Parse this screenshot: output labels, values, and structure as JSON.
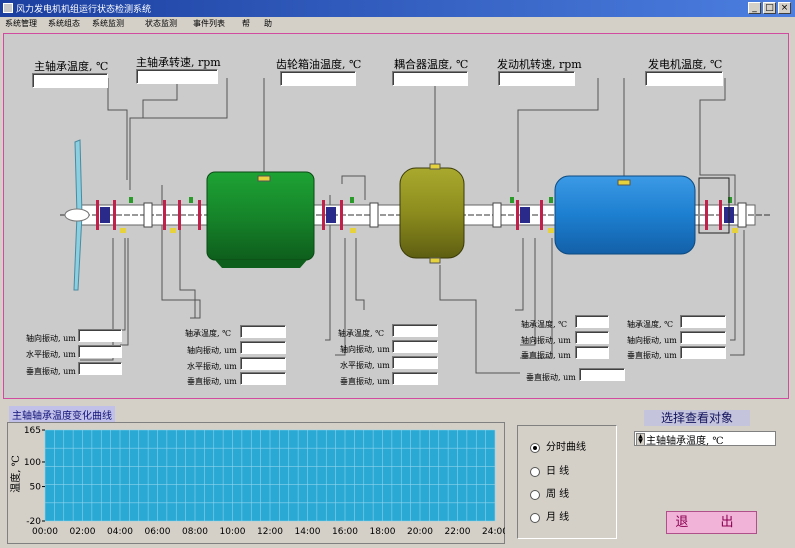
{
  "window": {
    "title": "风力发电机机组运行状态检测系统"
  },
  "menu": [
    "系统管理",
    "系统组态",
    "系统监测",
    "状态监测",
    "事件列表",
    "帮",
    "助"
  ],
  "top_fields": [
    {
      "label": "主轴承温度, ℃",
      "value": ""
    },
    {
      "label": "主轴承转速, rpm",
      "value": ""
    },
    {
      "label": "齿轮箱油温度, ℃",
      "value": ""
    },
    {
      "label": "耦合器温度, ℃",
      "value": ""
    },
    {
      "label": "发动机转速, rpm",
      "value": ""
    },
    {
      "label": "发电机温度, ℃",
      "value": ""
    }
  ],
  "groups": {
    "g1": [
      {
        "label": "轴向振动, um",
        "value": ""
      },
      {
        "label": "水平振动, um",
        "value": ""
      },
      {
        "label": "垂直振动, um",
        "value": ""
      }
    ],
    "g2": [
      {
        "label": "轴承温度, ℃",
        "value": ""
      },
      {
        "label": "轴向振动, um",
        "value": ""
      },
      {
        "label": "水平振动, um",
        "value": ""
      },
      {
        "label": "垂直振动, um",
        "value": ""
      }
    ],
    "g3": [
      {
        "label": "轴承温度, ℃",
        "value": ""
      },
      {
        "label": "轴向振动, um",
        "value": ""
      },
      {
        "label": "水平振动, um",
        "value": ""
      },
      {
        "label": "垂直振动, um",
        "value": ""
      }
    ],
    "g4": [
      {
        "label": "轴承温度, ℃",
        "value": ""
      },
      {
        "label": "轴向振动, um",
        "value": ""
      },
      {
        "label": "垂直振动, um",
        "value": ""
      }
    ],
    "g5": [
      {
        "label": "轴承温度, ℃",
        "value": ""
      },
      {
        "label": "轴向振动, um",
        "value": ""
      },
      {
        "label": "垂直振动, um",
        "value": ""
      }
    ],
    "g6": [
      {
        "label": "垂直振动, um",
        "value": ""
      }
    ]
  },
  "curve_section": {
    "title": "主轴轴承温度变化曲线"
  },
  "chart_data": {
    "type": "line",
    "title": "",
    "ylabel": "温度, ℃",
    "xlabel": "",
    "ylim": [
      -20,
      165
    ],
    "yticks": [
      "165",
      "100",
      "50",
      "-20"
    ],
    "ytick_values": [
      165,
      100,
      50,
      -20
    ],
    "xticks": [
      "00:00",
      "02:00",
      "04:00",
      "06:00",
      "08:00",
      "10:00",
      "12:00",
      "14:00",
      "16:00",
      "18:00",
      "20:00",
      "22:00",
      "24:00"
    ],
    "grid": true,
    "plot_color": "#29a9d4",
    "series": []
  },
  "period_options": [
    {
      "label": "分时曲线",
      "selected": true
    },
    {
      "label": "日 线",
      "selected": false
    },
    {
      "label": "周 线",
      "selected": false
    },
    {
      "label": "月 线",
      "selected": false
    }
  ],
  "select_target": {
    "title": "选择查看对象",
    "value": "主轴轴承温度, ℃"
  },
  "exit_label": "退 出",
  "colors": {
    "accent": "#d14ba0",
    "gearbox": "#1d8c2a",
    "coupler": "#8c8c1e",
    "generator": "#1d7fd0"
  }
}
